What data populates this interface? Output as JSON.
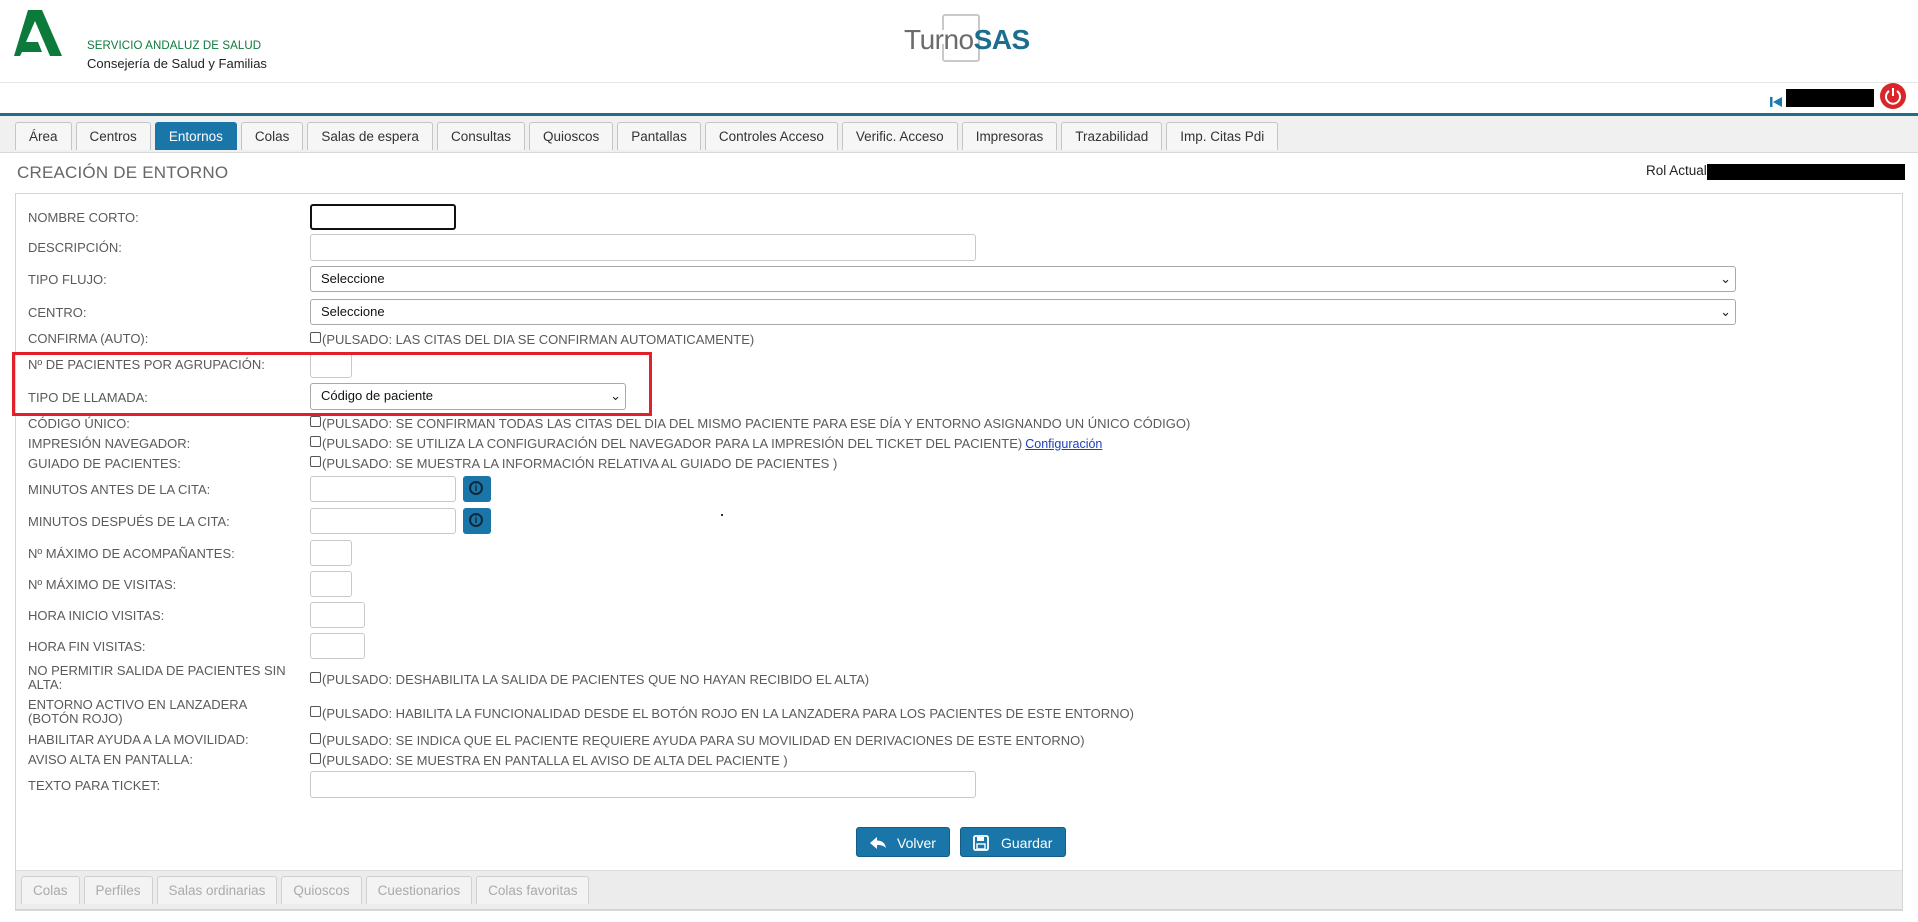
{
  "header": {
    "org_line1": "SERVICIO ANDALUZ DE SALUD",
    "org_line2": "Consejería de Salud y Familias",
    "app_name_part1": "Turno",
    "app_name_part2": "SAS"
  },
  "tabs": [
    "Área",
    "Centros",
    "Entornos",
    "Colas",
    "Salas de espera",
    "Consultas",
    "Quioscos",
    "Pantallas",
    "Controles Acceso",
    "Verific. Acceso",
    "Impresoras",
    "Trazabilidad",
    "Imp. Citas Pdi"
  ],
  "active_tab": "Entornos",
  "page": {
    "title": "CREACIÓN DE ENTORNO",
    "rol_label": "Rol Actual:"
  },
  "form": {
    "nombre_corto": "NOMBRE CORTO:",
    "descripcion": "DESCRIPCIÓN:",
    "tipo_flujo": "TIPO FLUJO:",
    "tipo_flujo_value": "Seleccione",
    "centro": "CENTRO:",
    "centro_value": "Seleccione",
    "confirma": "CONFIRMA (AUTO):",
    "confirma_desc": "(PULSADO: LAS CITAS DEL DIA SE CONFIRMAN AUTOMATICAMENTE)",
    "n_pacientes": "Nº DE PACIENTES POR AGRUPACIÓN:",
    "tipo_llamada": "TIPO DE LLAMADA:",
    "tipo_llamada_value": "Código de paciente",
    "codigo_unico": "CÓDIGO ÚNICO:",
    "codigo_unico_desc": "(PULSADO: SE CONFIRMAN TODAS LAS CITAS DEL DIA DEL MISMO PACIENTE PARA ESE DÍA Y ENTORNO ASIGNANDO UN ÚNICO CÓDIGO)",
    "impresion": "IMPRESIÓN NAVEGADOR:",
    "impresion_desc": "(PULSADO: SE UTILIZA LA CONFIGURACIÓN DEL NAVEGADOR PARA LA IMPRESIÓN DEL TICKET DEL PACIENTE)",
    "configuracion_link": "Configuración",
    "guiado": "GUIADO DE PACIENTES:",
    "guiado_desc": "(PULSADO: SE MUESTRA LA INFORMACIÓN RELATIVA AL GUIADO DE PACIENTES )",
    "minutos_antes": "MINUTOS ANTES DE LA CITA:",
    "minutos_despues": "MINUTOS DESPUÉS DE LA CITA:",
    "max_acompanantes": "Nº MÁXIMO DE ACOMPAÑANTES:",
    "max_visitas": "Nº MÁXIMO DE VISITAS:",
    "hora_inicio": "HORA INICIO VISITAS:",
    "hora_fin": "HORA FIN VISITAS:",
    "no_permitir": "NO PERMITIR SALIDA DE PACIENTES SIN ALTA:",
    "no_permitir_desc": "(PULSADO: DESHABILITA LA SALIDA DE PACIENTES QUE NO HAYAN RECIBIDO EL ALTA)",
    "entorno_activo": "ENTORNO ACTIVO EN LANZADERA (BOTÓN ROJO)",
    "entorno_activo_desc": "(PULSADO: HABILITA LA FUNCIONALIDAD DESDE EL BOTÓN ROJO EN LA LANZADERA PARA LOS PACIENTES DE ESTE ENTORNO)",
    "ayuda_movilidad": "HABILITAR AYUDA A LA MOVILIDAD:",
    "ayuda_movilidad_desc": "(PULSADO: SE INDICA QUE EL PACIENTE REQUIERE AYUDA PARA SU MOVILIDAD EN DERIVACIONES DE ESTE ENTORNO)",
    "aviso_alta": "AVISO ALTA EN PANTALLA:",
    "aviso_alta_desc": "(PULSADO: SE MUESTRA EN PANTALLA EL AVISO DE ALTA DEL PACIENTE )",
    "texto_ticket": "TEXTO PARA TICKET:"
  },
  "buttons": {
    "volver": "Volver",
    "guardar": "Guardar"
  },
  "bottom_tabs": [
    "Colas",
    "Perfiles",
    "Salas ordinarias",
    "Quioscos",
    "Cuestionarios",
    "Colas favoritas"
  ],
  "colors": {
    "accent": "#1a75a8",
    "highlight": "#e0202b",
    "power": "#d9262b",
    "logo_green": "#0b7a3b"
  },
  "icons": {
    "first_page": "first-page-icon",
    "power": "power-icon",
    "info": "info-icon",
    "back": "reply-arrow-icon",
    "save": "floppy-disk-icon"
  }
}
